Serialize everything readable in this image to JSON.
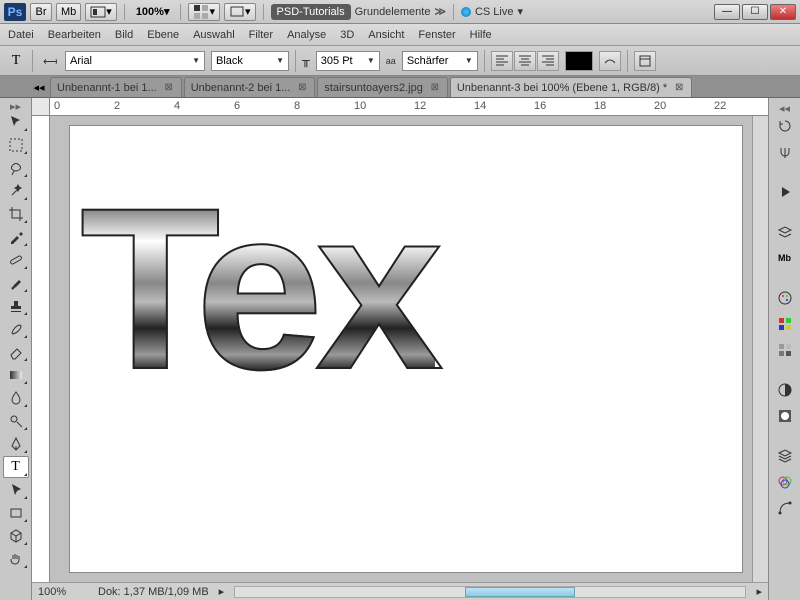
{
  "app_bar": {
    "logo": "Ps",
    "br": "Br",
    "mb": "Mb",
    "zoom": "100%",
    "panel1": "PSD-Tutorials",
    "panel2": "Grundelemente",
    "cslive": "CS Live"
  },
  "menu": [
    "Datei",
    "Bearbeiten",
    "Bild",
    "Ebene",
    "Auswahl",
    "Filter",
    "Analyse",
    "3D",
    "Ansicht",
    "Fenster",
    "Hilfe"
  ],
  "options": {
    "font_family": "Arial",
    "font_style": "Black",
    "font_size": "305 Pt",
    "aa_prefix": "aa",
    "aa": "Schärfer"
  },
  "tabs": [
    {
      "label": "Unbenannt-1 bei 1...",
      "active": false
    },
    {
      "label": "Unbenannt-2 bei 1...",
      "active": false
    },
    {
      "label": "stairsuntoayers2.jpg",
      "active": false
    },
    {
      "label": "Unbenannt-3 bei 100% (Ebene 1, RGB/8) *",
      "active": true
    }
  ],
  "ruler_ticks": [
    "0",
    "2",
    "4",
    "6",
    "8",
    "10",
    "12",
    "14",
    "16",
    "18",
    "20",
    "22"
  ],
  "canvas_text": "Tex",
  "status": {
    "zoom": "100%",
    "doc": "Dok: 1,37 MB/1,09 MB"
  }
}
